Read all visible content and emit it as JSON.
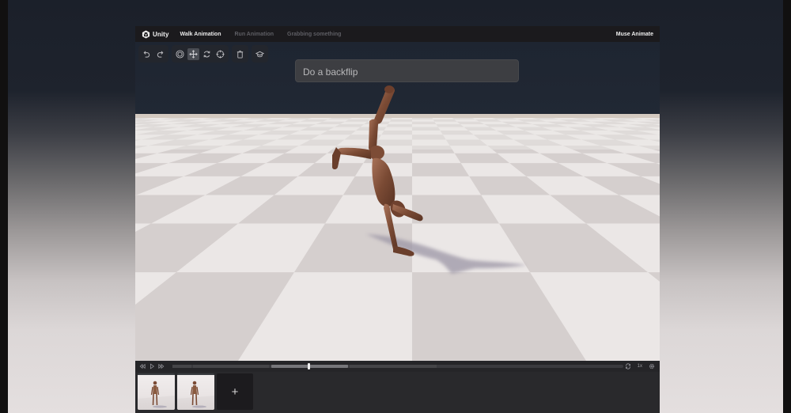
{
  "header": {
    "logo_text": "Unity",
    "tabs": [
      {
        "label": "Walk Animation",
        "active": true
      },
      {
        "label": "Run Animation",
        "active": false
      },
      {
        "label": "Grabbing something",
        "active": false
      }
    ],
    "brand": "Muse Animate"
  },
  "toolbar": {
    "groups": [
      [
        {
          "icon": "undo-icon"
        },
        {
          "icon": "redo-icon"
        }
      ],
      [
        {
          "icon": "target-icon"
        },
        {
          "icon": "move-icon",
          "active": true
        },
        {
          "icon": "rotate-icon"
        },
        {
          "icon": "crosshair-icon"
        }
      ],
      [
        {
          "icon": "trash-icon"
        }
      ],
      [
        {
          "icon": "tutorial-icon"
        }
      ]
    ]
  },
  "prompt": {
    "value": "Do a backflip"
  },
  "timeline": {
    "playhead_fraction": 0.302,
    "selected_range": [
      0.219,
      0.39
    ],
    "speed_label": "1x"
  },
  "clips": {
    "items": [
      {
        "label": "clip-1"
      },
      {
        "label": "clip-2"
      }
    ],
    "add_label": "+"
  },
  "colors": {
    "figure": "#8a5a40",
    "app_bg": "#1a1d24",
    "timeline_bg": "#252528"
  }
}
